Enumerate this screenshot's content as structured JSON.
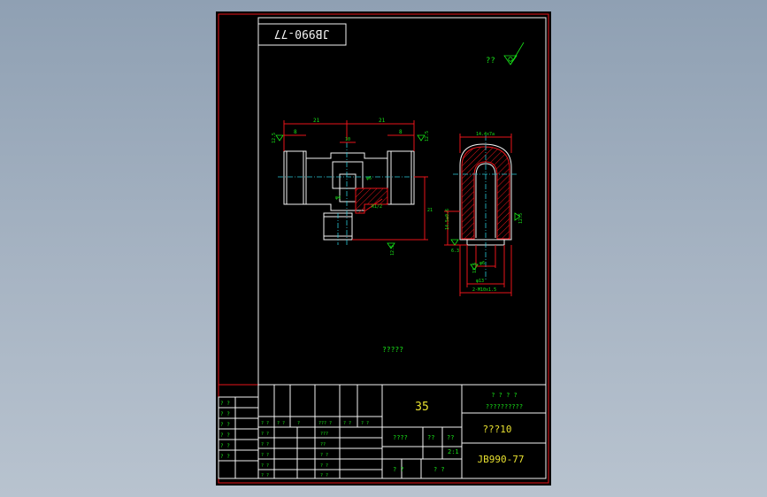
{
  "drawing": {
    "code_box_rotated": "JB990-77",
    "roughness_note": "??",
    "roughness_symbol": "check-triangle-icon",
    "center_note": "?????",
    "dims_front": {
      "left_top": "21",
      "right_top": "21",
      "left_inner": "8",
      "right_inner": "8",
      "center_small": "10",
      "phi_a": "φ6",
      "phi_b": "φ4",
      "r_note": "R1/2",
      "height_right": "21",
      "rough_left": "12.5",
      "rough_right": "12.5",
      "rough_bottom": "12.5"
    },
    "dims_side": {
      "top": "14.4x7a",
      "left_height": "14.5±0.6",
      "phi_small": "φ6",
      "phi_large": "φ13",
      "thread": "2-M10x1.5",
      "rough_a": "6.3",
      "rough_b": "12.5",
      "rough_c": "12.5"
    }
  },
  "title_block": {
    "left_col": [
      "? ?",
      "? ?",
      "? ?",
      "? ?",
      "? ?",
      "? ?"
    ],
    "grid_row1": [
      "? ?",
      "? ?",
      "?",
      "? ?",
      "??? ?",
      "? ?",
      "? ?"
    ],
    "grid_row2": [
      "? ?",
      "? ?",
      "???"
    ],
    "grid_row3": [
      "? ?",
      "? ?",
      "??",
      "? ?"
    ],
    "grid_row4": [
      "? ?",
      "? ?",
      "? ?"
    ],
    "material": "35",
    "header_q": "? ? ? ?",
    "header_q2": "??????????",
    "part_name": "???10",
    "stage_label": "????",
    "weight_label": "??",
    "scale_label": "??",
    "scale_value": "2:1",
    "sheet_label": "? ?",
    "sheet_label2": "? ?",
    "drawing_no": "JB990-77"
  }
}
